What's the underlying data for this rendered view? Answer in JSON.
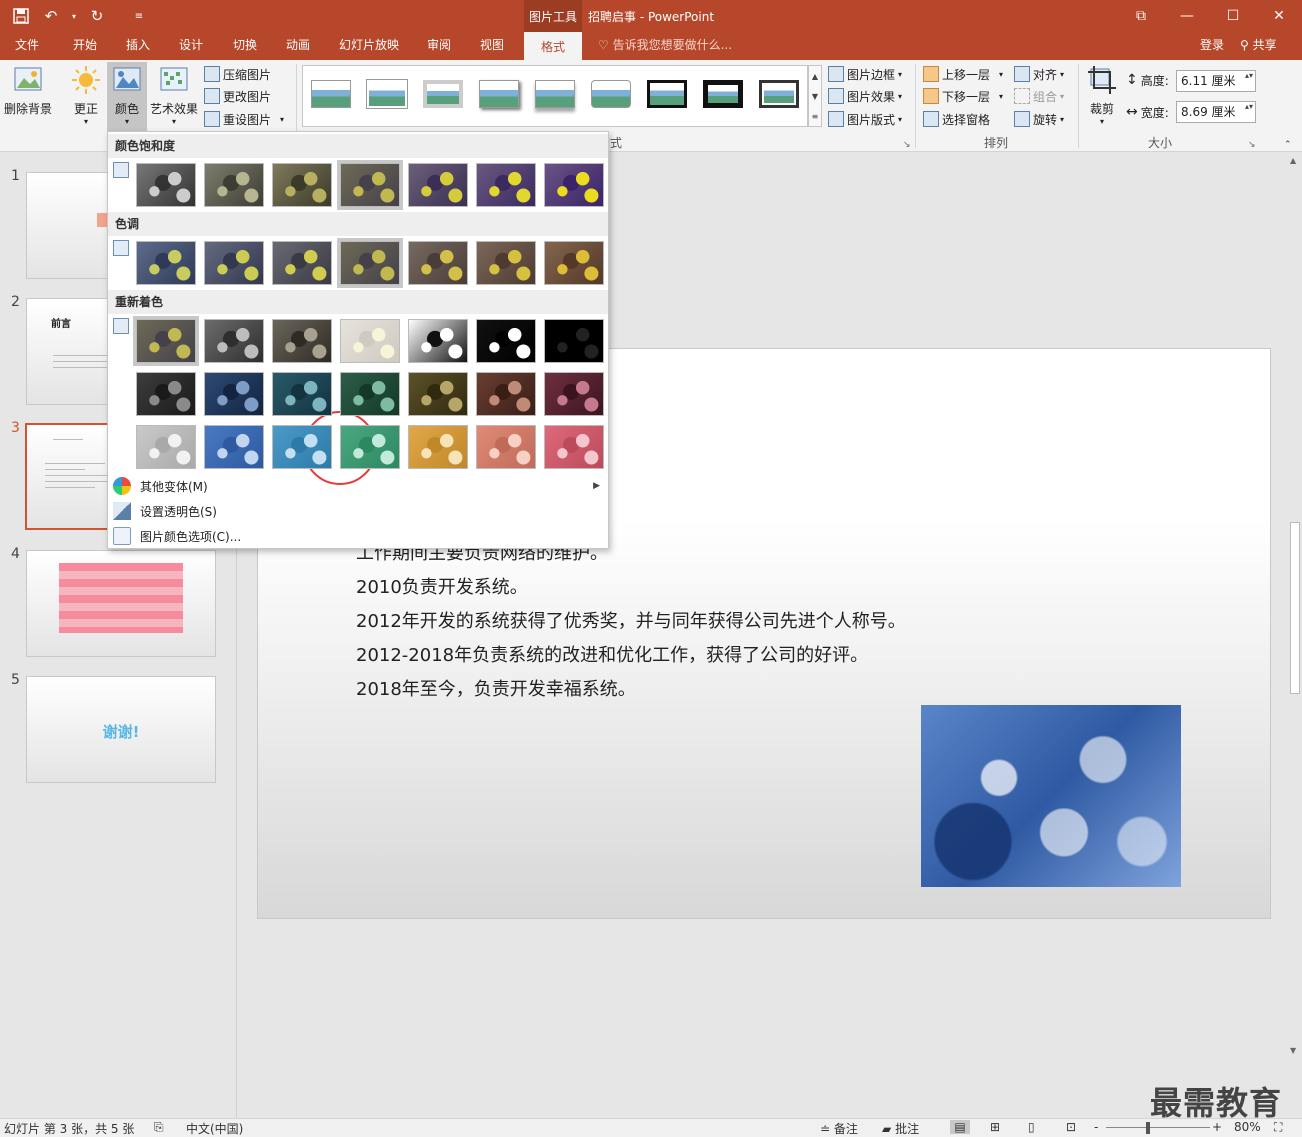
{
  "title_bar": {
    "context_tab": "图片工具",
    "doc_title": "招聘启事 - PowerPoint",
    "icons": [
      "save-icon",
      "undo-icon",
      "redo-icon",
      "customize-qat-icon",
      "ribbon-display-icon",
      "minimize-icon",
      "maximize-icon",
      "close-icon"
    ]
  },
  "tabs": {
    "file": "文件",
    "home": "开始",
    "insert": "插入",
    "design": "设计",
    "transitions": "切换",
    "animations": "动画",
    "slideshow": "幻灯片放映",
    "review": "审阅",
    "view": "视图",
    "format": "格式",
    "tellme": "告诉我您想要做什么...",
    "login": "登录",
    "share": "共享"
  },
  "ribbon": {
    "remove_bg": "删除背景",
    "corrections": "更正",
    "color": "颜色",
    "artistic": "艺术效果",
    "compress": "压缩图片",
    "change_pic": "更改图片",
    "reset_pic": "重设图片",
    "pic_border": "图片边框",
    "pic_effects": "图片效果",
    "pic_layout": "图片版式",
    "styles_label_tail": "式",
    "bring_forward": "上移一层",
    "send_backward": "下移一层",
    "selection_pane": "选择窗格",
    "align": "对齐",
    "group": "组合",
    "rotate": "旋转",
    "arrange_label": "排列",
    "crop": "裁剪",
    "height_label": "高度:",
    "height_value": "6.11 厘米",
    "width_label": "宽度:",
    "width_value": "8.69 厘米",
    "size_label": "大小"
  },
  "dropdown": {
    "section_saturation": "颜色饱和度",
    "section_tone": "色调",
    "section_recolor": "重新着色",
    "more_variations": "其他变体(M)",
    "set_transparent": "设置透明色(S)",
    "color_options": "图片颜色选项(C)..."
  },
  "thumbnails": {
    "numbers": [
      "1",
      "2",
      "3",
      "4",
      "5"
    ],
    "slide2_title": "前言",
    "slide5_text": "谢谢!"
  },
  "slide": {
    "bullets": [
      "工作期间主要负责网络的维护。",
      "2010负责开发系统。",
      "2012年开发的系统获得了优秀奖，并与同年获得公司先进个人称号。",
      "2012-2018年负责系统的改进和优化工作，获得了公司的好评。",
      "2018年至今，负责开发幸福系统。"
    ]
  },
  "statusbar": {
    "slide_info": "幻灯片 第 3 张，共 5 张",
    "language": "中文(中国)",
    "notes": "备注",
    "comments": "批注",
    "zoom_minus": "-",
    "zoom_plus": "+",
    "zoom": "80%"
  },
  "watermark": "最需教育",
  "colors": {
    "accent": "#b7472a",
    "highlight_circle": "#e53935"
  }
}
